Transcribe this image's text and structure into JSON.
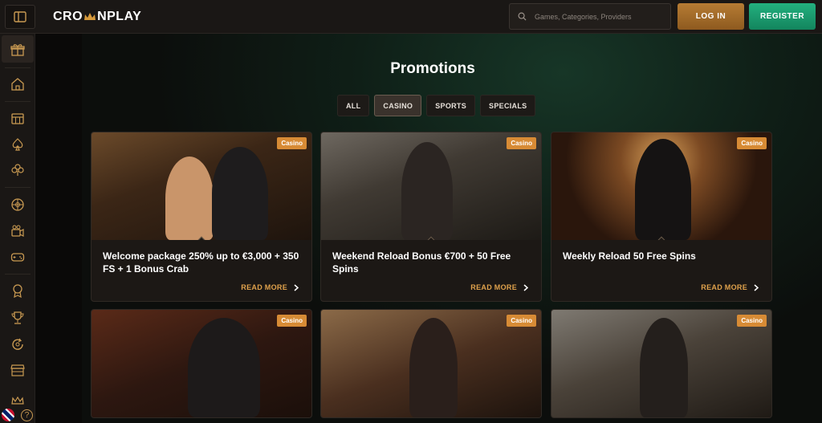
{
  "header": {
    "logo_left": "CRO",
    "logo_right": "NPLAY",
    "search_placeholder": "Games, Categories, Providers",
    "login_label": "LOG IN",
    "register_label": "REGISTER"
  },
  "sidebar": {
    "icons": [
      "gift-icon",
      "home-icon",
      "slot-machine-icon",
      "spade-icon",
      "clover-icon",
      "roulette-icon",
      "live-camera-icon",
      "gamepad-icon",
      "badge-icon",
      "trophy-icon",
      "spin-icon",
      "store-icon",
      "crown-icon"
    ],
    "help_label": "?"
  },
  "main": {
    "title": "Promotions",
    "tabs": [
      {
        "label": "ALL"
      },
      {
        "label": "CASINO"
      },
      {
        "label": "SPORTS"
      },
      {
        "label": "SPECIALS"
      }
    ],
    "active_tab": "CASINO",
    "cards": [
      {
        "badge": "Casino",
        "title": "Welcome package 250% up to €3,000 + 350 FS + 1 Bonus Crab",
        "more": "READ MORE"
      },
      {
        "badge": "Casino",
        "title": "Weekend Reload Bonus €700 + 50 Free Spins",
        "more": "READ MORE"
      },
      {
        "badge": "Casino",
        "title": "Weekly Reload 50 Free Spins",
        "more": "READ MORE"
      },
      {
        "badge": "Casino",
        "title": "",
        "more": ""
      },
      {
        "badge": "Casino",
        "title": "",
        "more": ""
      },
      {
        "badge": "Casino",
        "title": "",
        "more": ""
      }
    ]
  },
  "colors": {
    "accent_gold": "#d78b35",
    "register_green": "#1aa372",
    "login_bronze": "#a46c2a"
  }
}
